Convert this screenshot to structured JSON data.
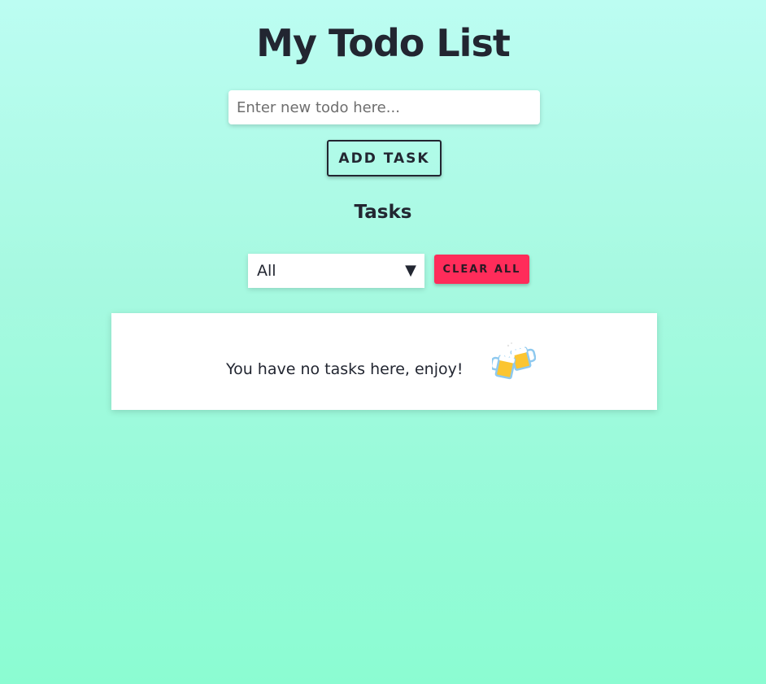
{
  "header": {
    "title": "My Todo List"
  },
  "input": {
    "placeholder": "Enter new todo here...",
    "value": ""
  },
  "add_button": {
    "label": "ADD TASK"
  },
  "tasks_section": {
    "heading": "Tasks",
    "filter": {
      "selected": "All",
      "arrow": "▼"
    },
    "clear_button": {
      "label": "CLEAR ALL"
    },
    "empty_message": "You have no tasks here, enjoy!",
    "empty_icon": "clinking-beer-mugs-icon"
  },
  "colors": {
    "background_top": "#bcfdf2",
    "background_bottom": "#8bfcd2",
    "text": "#222631",
    "clear_button": "#ff2c5a",
    "panel": "#ffffff"
  }
}
